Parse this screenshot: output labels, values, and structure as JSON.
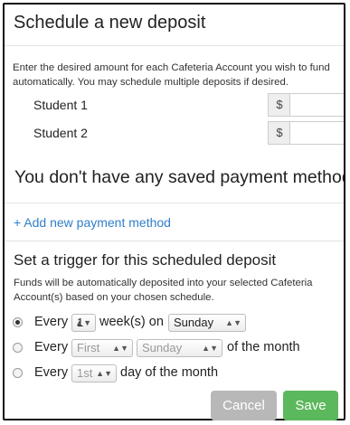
{
  "header": {
    "title": "Schedule a new deposit"
  },
  "intro_text": "Enter the desired amount for each Cafeteria Account you wish to fund automatically. You may schedule multiple deposits if desired.",
  "students": [
    {
      "label": "Student 1",
      "currency": "$",
      "amount": ""
    },
    {
      "label": "Student 2",
      "currency": "$",
      "amount": ""
    }
  ],
  "payment": {
    "empty_message": "You don't have any saved payment methods.",
    "add_link": "+ Add new payment method"
  },
  "trigger": {
    "title": "Set a trigger for this scheduled deposit",
    "description": "Funds will be automatically deposited into your selected Cafeteria Account(s) based on your chosen schedule.",
    "options": [
      {
        "selected": true,
        "prefix": "Every",
        "count": "1",
        "mid": "week(s) on",
        "day": "Sunday"
      },
      {
        "selected": false,
        "prefix": "Every",
        "ordinal": "First",
        "day": "Sunday",
        "suffix": "of the month"
      },
      {
        "selected": false,
        "prefix": "Every",
        "date": "1st",
        "suffix": "day of the month"
      }
    ]
  },
  "buttons": {
    "cancel": "Cancel",
    "save": "Save"
  },
  "colors": {
    "link": "#2f7fc8",
    "save": "#5cb85c",
    "cancel": "#b8b8b8"
  }
}
